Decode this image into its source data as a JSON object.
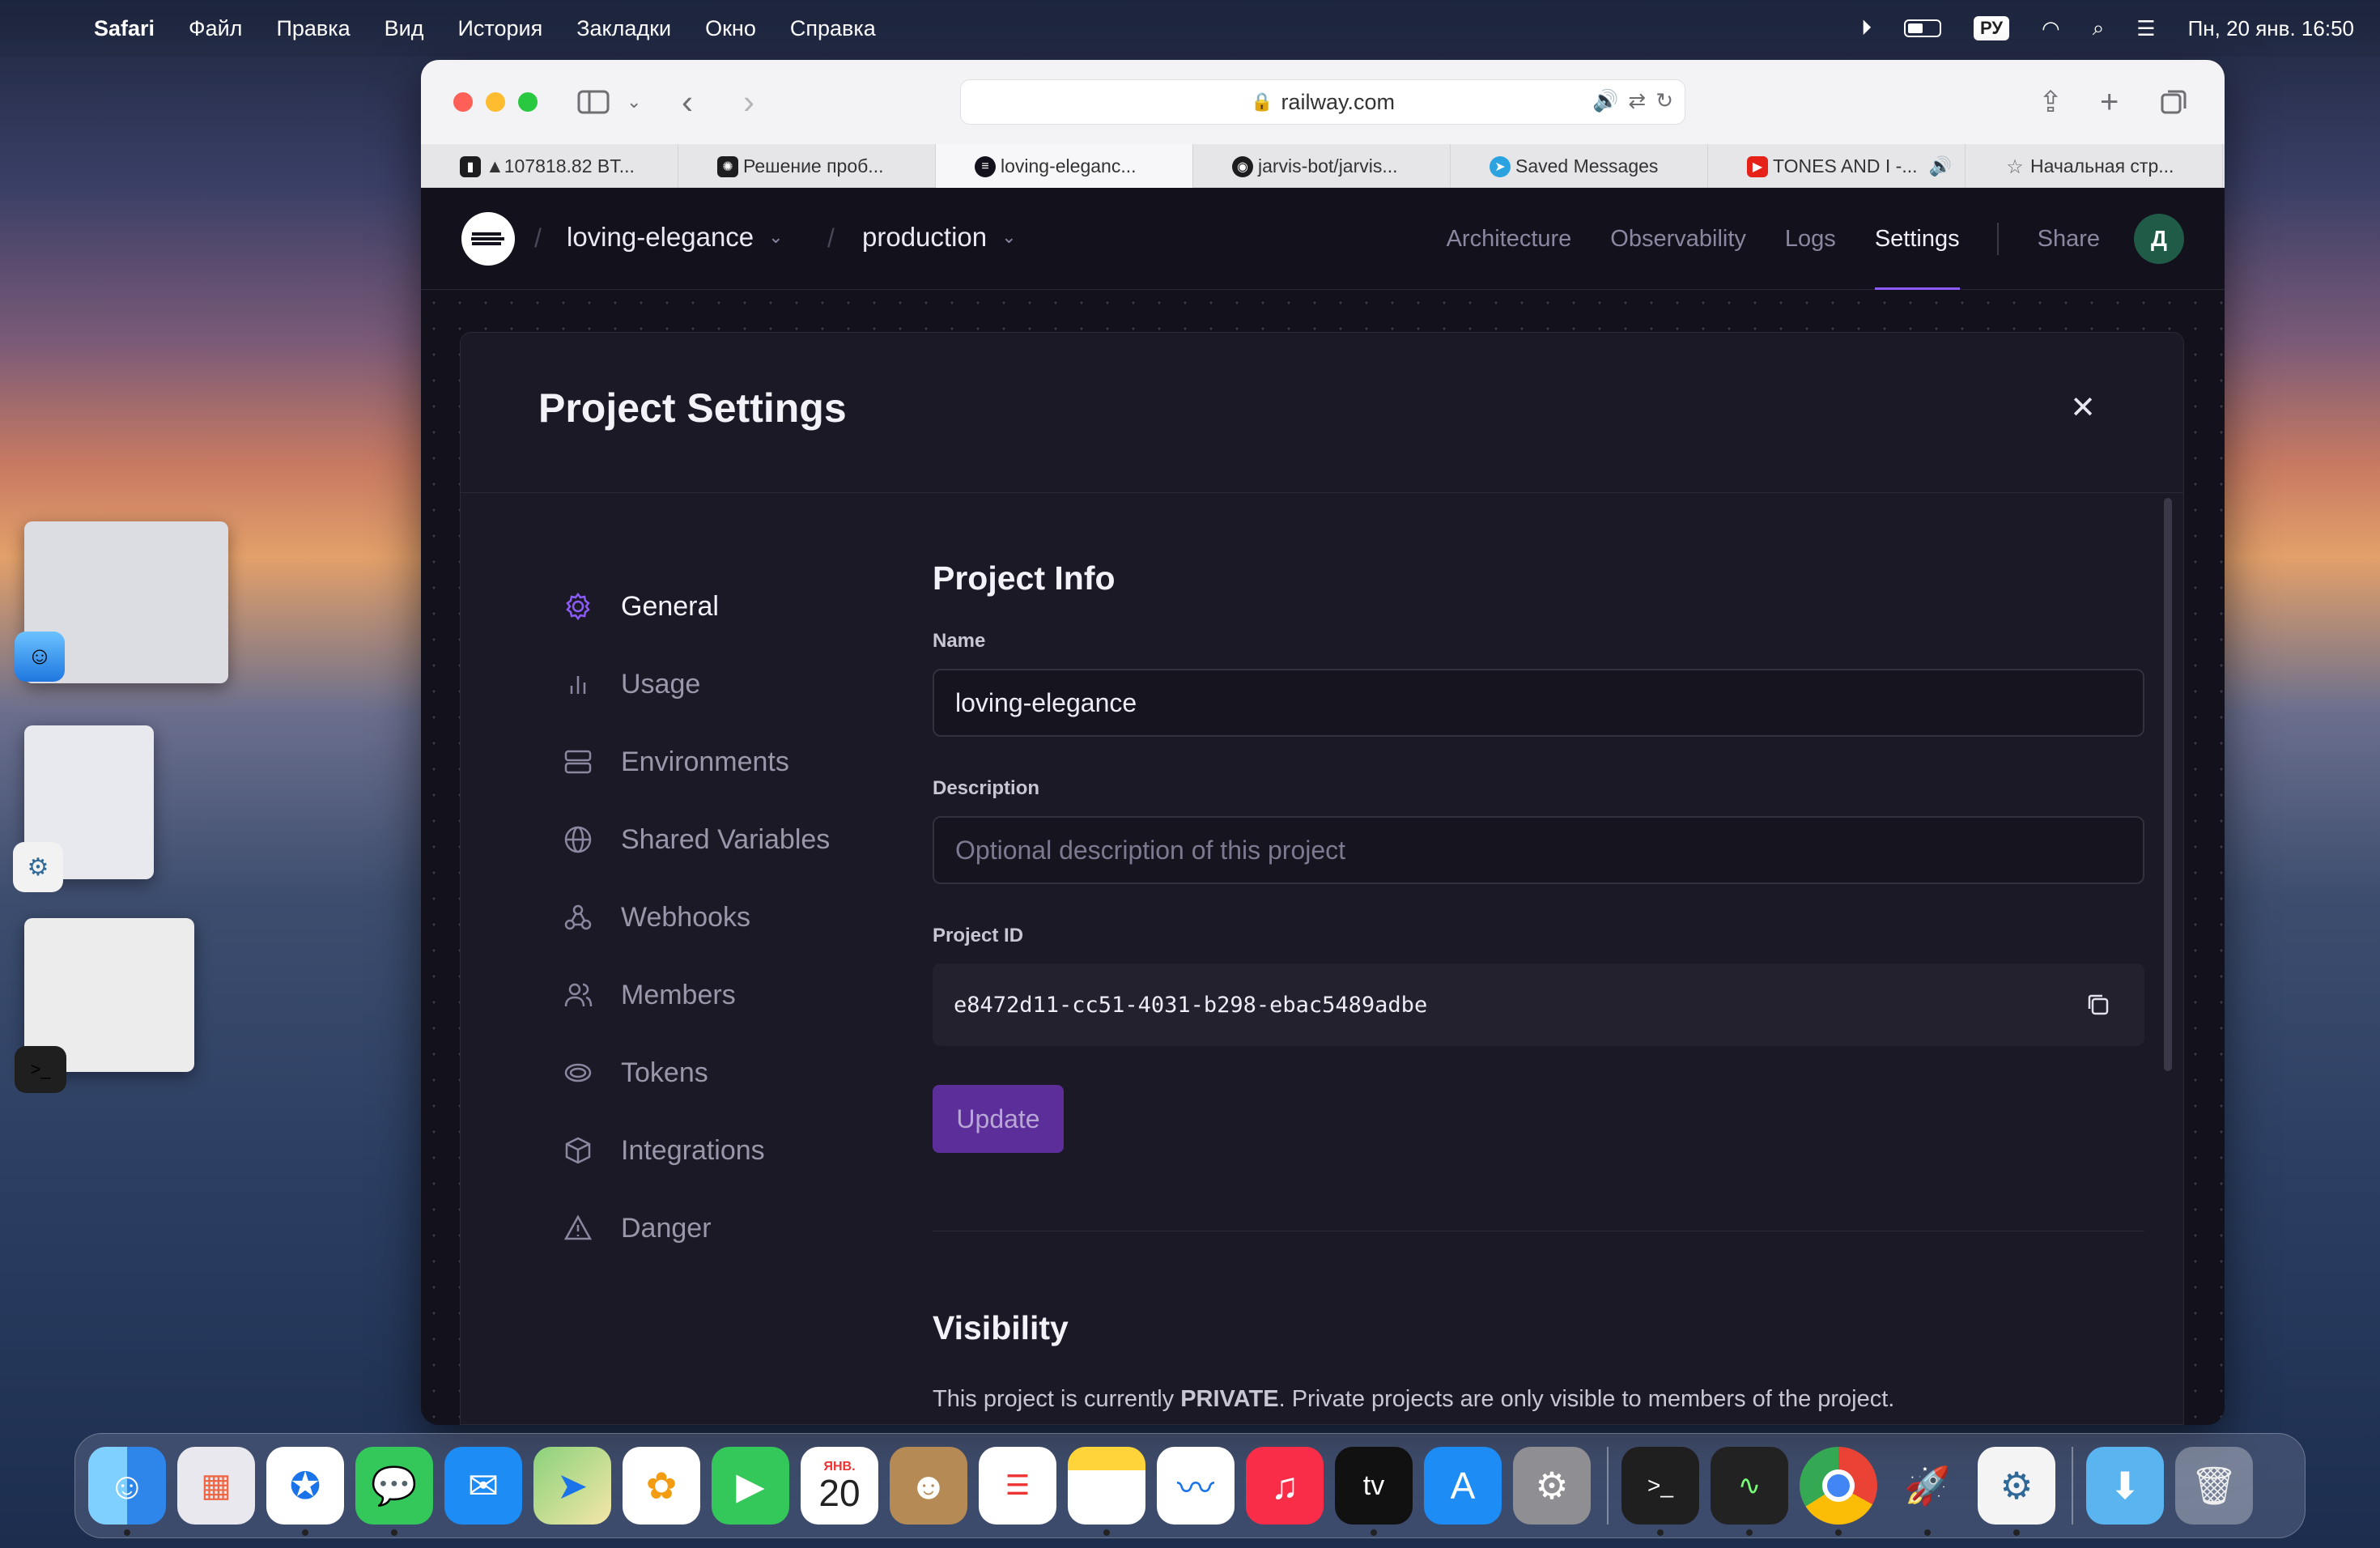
{
  "menubar": {
    "app_name": "Safari",
    "items": [
      "Файл",
      "Правка",
      "Вид",
      "История",
      "Закладки",
      "Окно",
      "Справка"
    ],
    "lang": "РУ",
    "clock": "Пн, 20 янв.  16:50"
  },
  "browser": {
    "url": "railway.com",
    "tabs": [
      {
        "label": "▲107818.82 BT...",
        "favicon_color": "#1d1d1f"
      },
      {
        "label": "Решение проб...",
        "favicon_color": "#1d1d1f"
      },
      {
        "label": "loving-eleganc...",
        "favicon_color": "#13111c"
      },
      {
        "label": "jarvis-bot/jarvis...",
        "favicon_color": "#1d1d1f"
      },
      {
        "label": "Saved Messages",
        "favicon_color": "#2aa3e0"
      },
      {
        "label": "TONES AND I -...",
        "favicon_color": "#e62117"
      },
      {
        "label": "Начальная стр...",
        "favicon_color": "#888888"
      }
    ]
  },
  "app": {
    "project": "loving-elegance",
    "environment": "production",
    "nav": [
      "Architecture",
      "Observability",
      "Logs",
      "Settings",
      "Share"
    ],
    "avatar_initial": "Д"
  },
  "settings": {
    "title": "Project Settings",
    "sidebar": [
      {
        "label": "General",
        "icon": "gear-icon"
      },
      {
        "label": "Usage",
        "icon": "bar-chart-icon"
      },
      {
        "label": "Environments",
        "icon": "server-icon"
      },
      {
        "label": "Shared Variables",
        "icon": "globe-icon"
      },
      {
        "label": "Webhooks",
        "icon": "webhook-icon"
      },
      {
        "label": "Members",
        "icon": "users-icon"
      },
      {
        "label": "Tokens",
        "icon": "token-icon"
      },
      {
        "label": "Integrations",
        "icon": "box-icon"
      },
      {
        "label": "Danger",
        "icon": "warning-icon"
      }
    ],
    "project_info": {
      "heading": "Project Info",
      "name_label": "Name",
      "name_value": "loving-elegance",
      "description_label": "Description",
      "description_placeholder": "Optional description of this project",
      "id_label": "Project ID",
      "id_value": "e8472d11-cc51-4031-b298-ebac5489adbe",
      "update_label": "Update"
    },
    "visibility": {
      "heading": "Visibility",
      "text_pre": "This project is currently ",
      "text_bold": "PRIVATE",
      "text_post": ". Private projects are only visible to members of the project."
    }
  },
  "dock": {
    "apps": [
      "finder",
      "launchpad",
      "safari",
      "messages",
      "mail",
      "maps",
      "photos",
      "facetime",
      "calendar",
      "contacts",
      "reminders",
      "notes",
      "freeform",
      "music",
      "tv",
      "app-store",
      "system-settings",
      "terminal",
      "activity-monitor",
      "chrome",
      "rocket",
      "python",
      "downloads",
      "trash"
    ],
    "calendar_month": "ЯНВ.",
    "calendar_day": "20",
    "tv_label": "tv"
  }
}
